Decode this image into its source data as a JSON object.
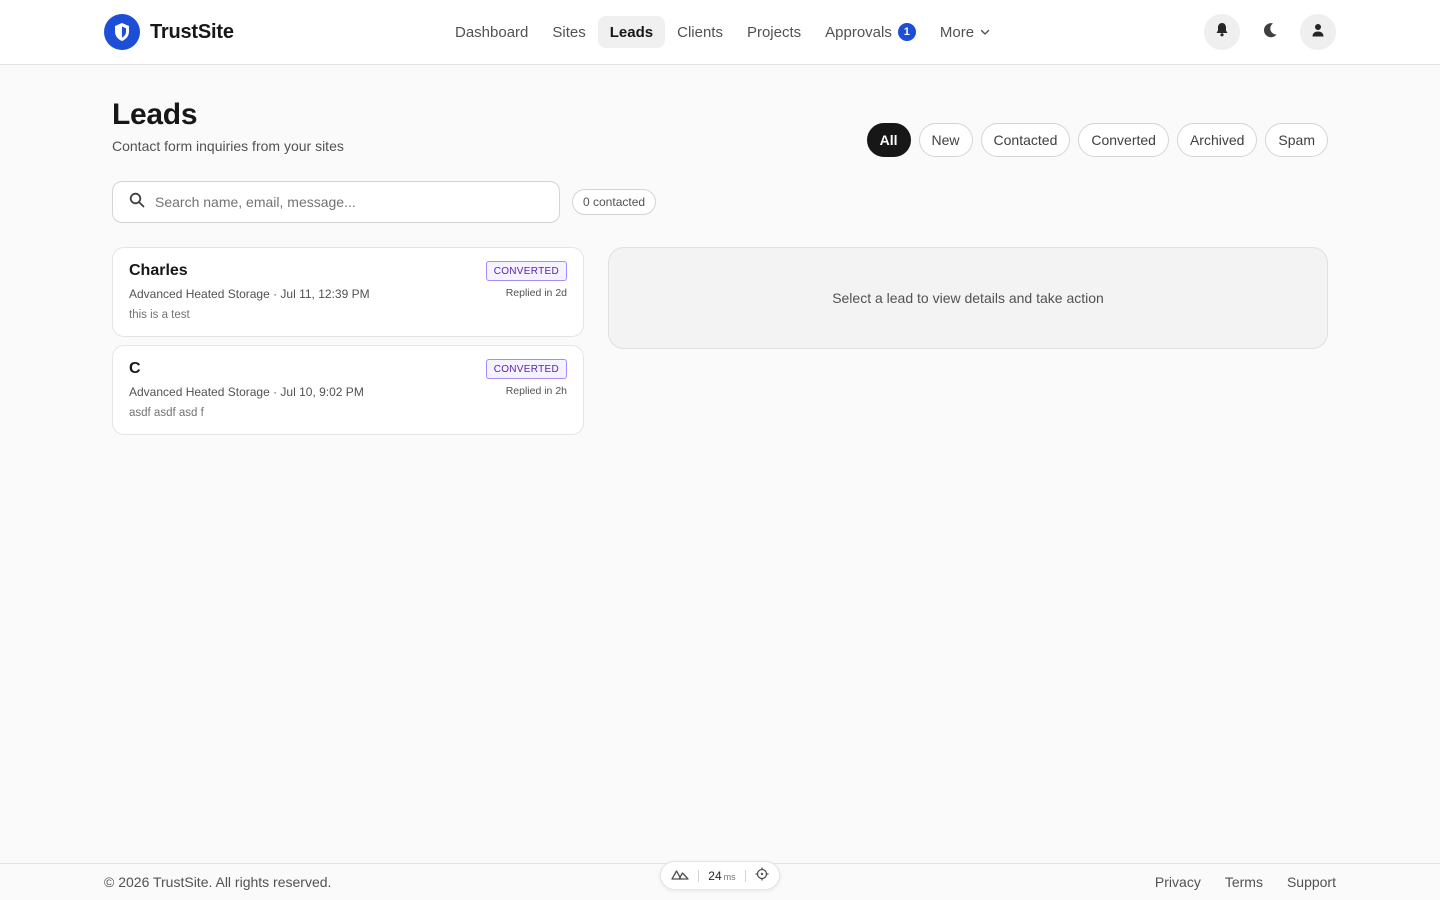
{
  "app": {
    "name": "TrustSite",
    "accent": "#1d4ed8"
  },
  "nav": {
    "items": [
      {
        "label": "Dashboard"
      },
      {
        "label": "Sites"
      },
      {
        "label": "Leads",
        "active": true
      },
      {
        "label": "Clients"
      },
      {
        "label": "Projects"
      },
      {
        "label": "Approvals",
        "badge": "1"
      },
      {
        "label": "More",
        "icon": "chevron-down-icon"
      }
    ]
  },
  "topbar_icons": [
    "bell-icon",
    "moon-icon",
    "user-icon"
  ],
  "page": {
    "title": "Leads",
    "subtitle": "Contact form inquiries from your sites"
  },
  "filters": [
    {
      "label": "All",
      "active": true
    },
    {
      "label": "New"
    },
    {
      "label": "Contacted"
    },
    {
      "label": "Converted"
    },
    {
      "label": "Archived"
    },
    {
      "label": "Spam"
    }
  ],
  "search": {
    "placeholder": "Search name, email, message...",
    "value": ""
  },
  "contacted_count": "0 contacted",
  "leads": [
    {
      "name": "Charles",
      "meta": "Advanced Heated Storage · Jul 11, 12:39 PM",
      "message": "this is a test",
      "status": "CONVERTED",
      "replied": "Replied in 2d"
    },
    {
      "name": "C",
      "meta": "Advanced Heated Storage · Jul 10, 9:02 PM",
      "message": "asdf asdf asd f",
      "status": "CONVERTED",
      "replied": "Replied in 2h"
    }
  ],
  "detail": {
    "empty_text": "Select a lead to view details and take action"
  },
  "footer": {
    "copyright": "© 2026 TrustSite. All rights reserved.",
    "links": [
      "Privacy",
      "Terms",
      "Support"
    ]
  },
  "devtools": {
    "value": "24",
    "unit": "ms"
  }
}
